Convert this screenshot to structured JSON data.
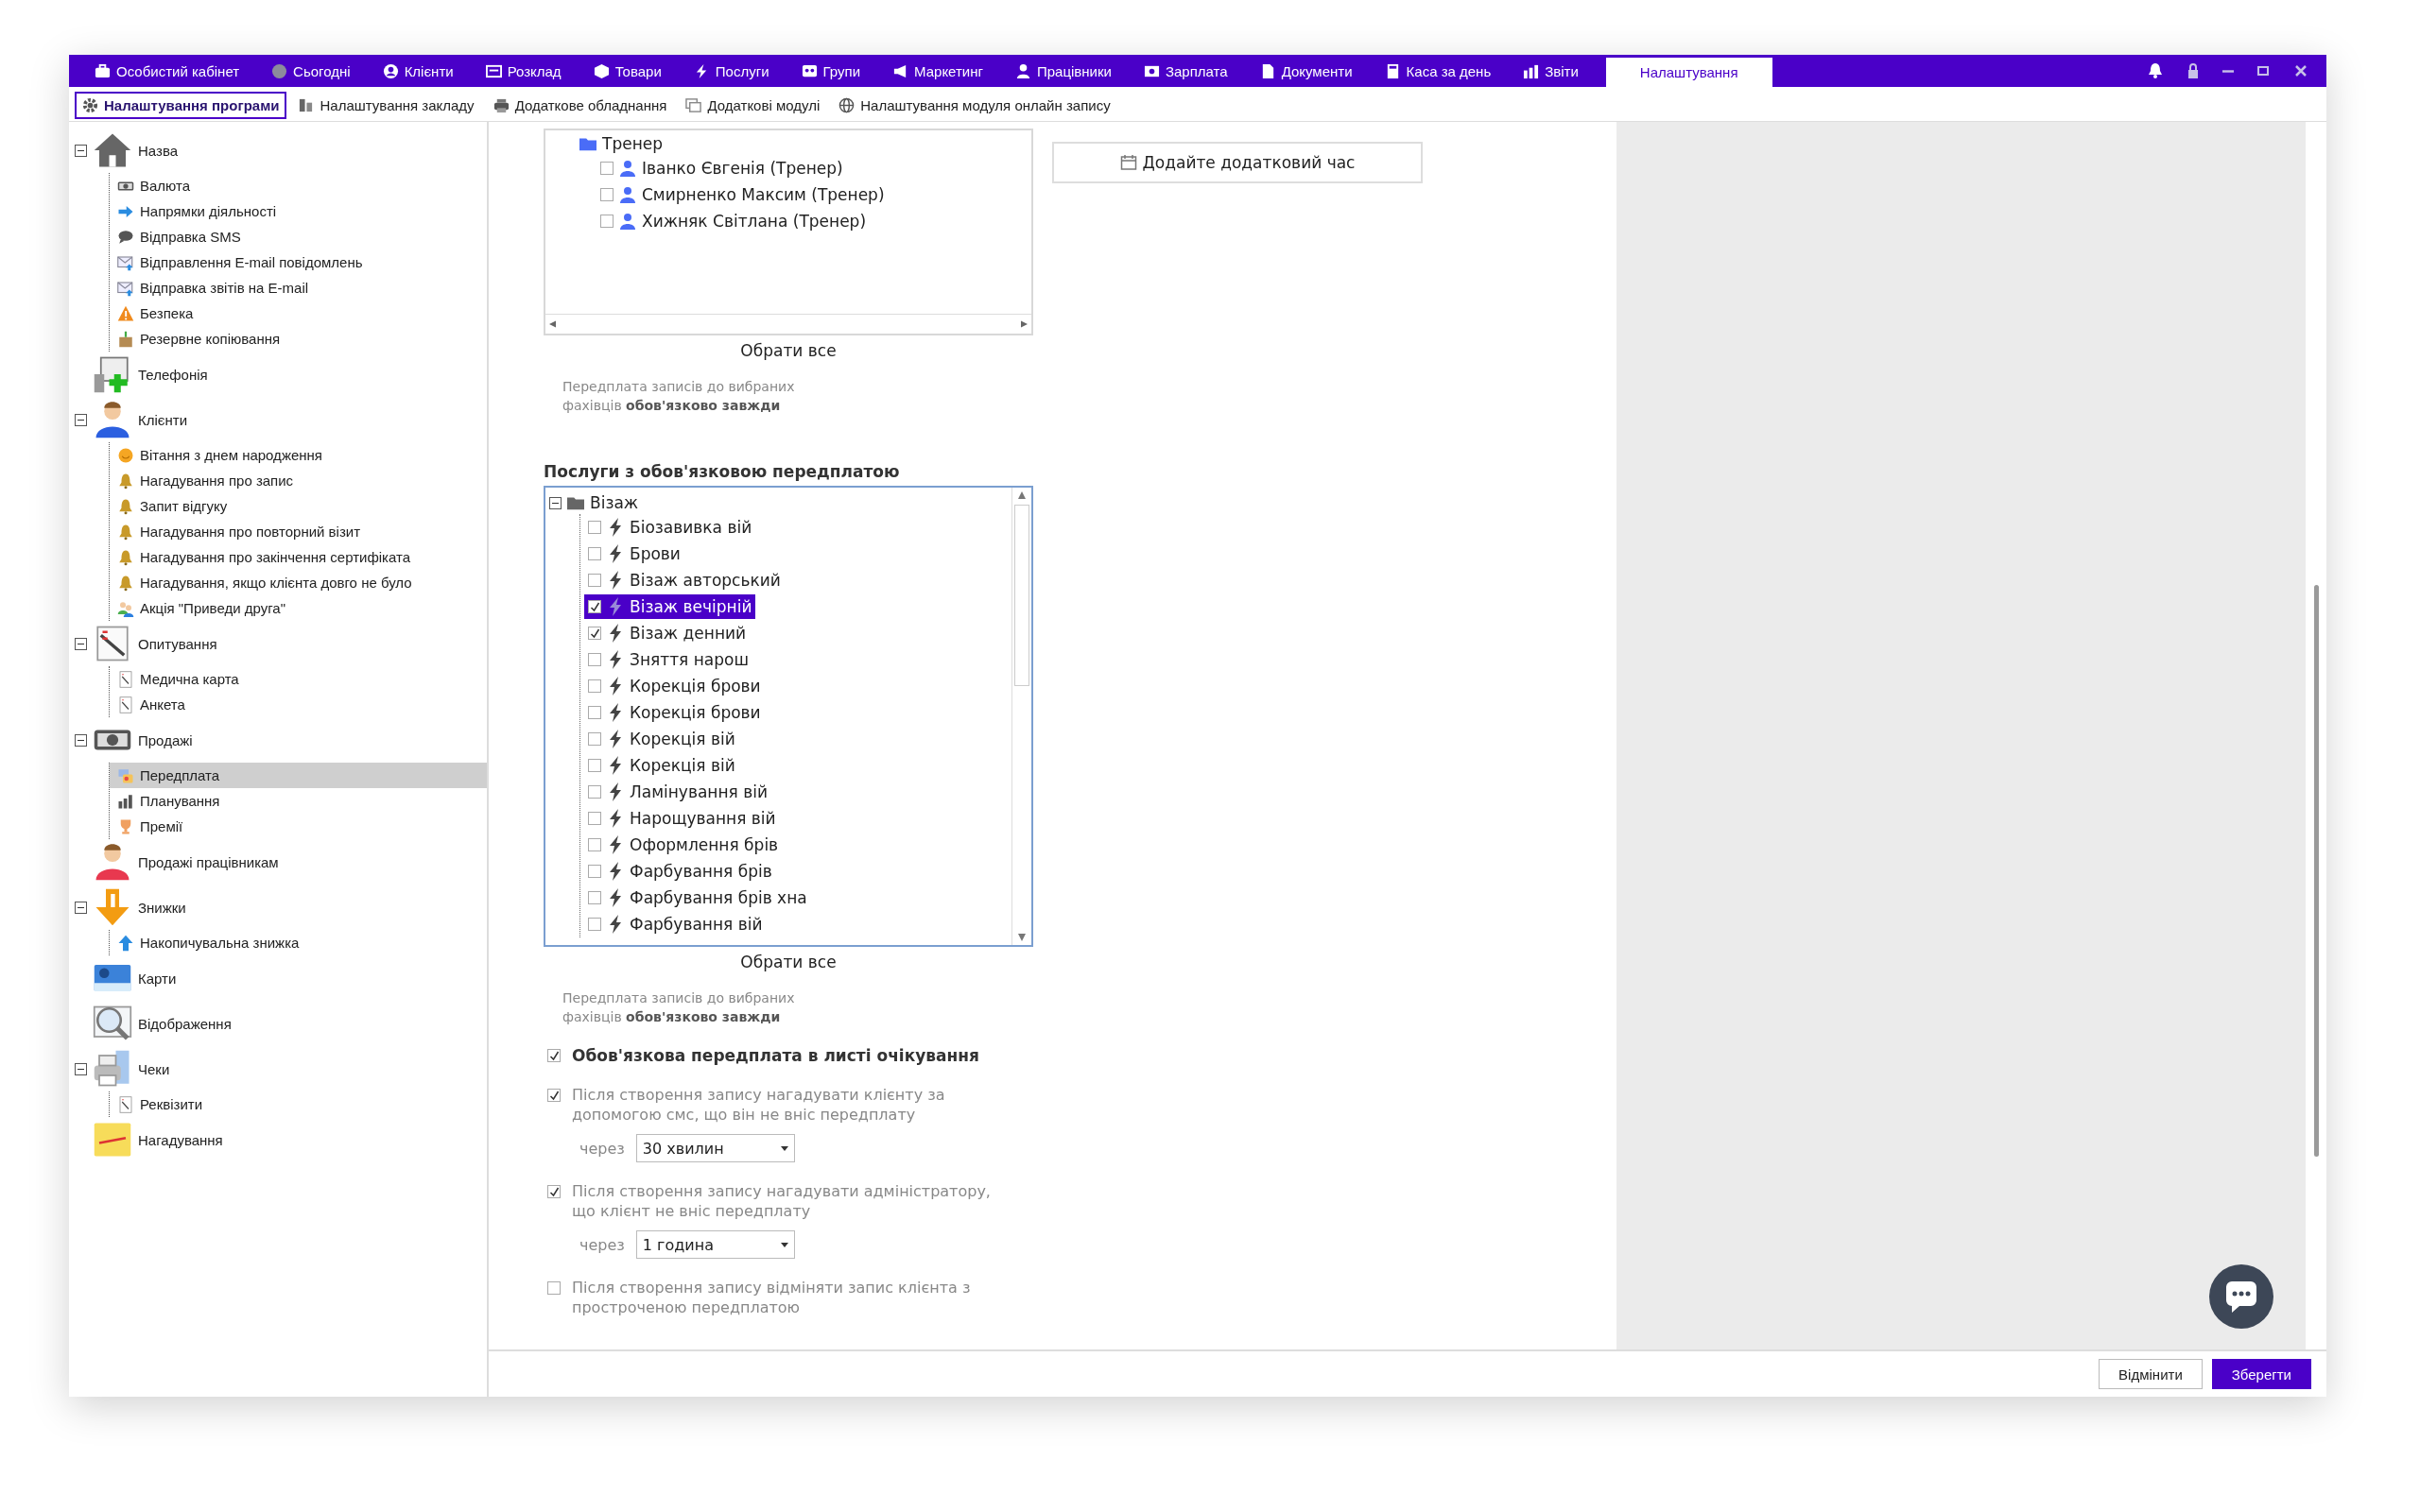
{
  "top_nav": {
    "items": [
      {
        "label": "Особистий кабінет",
        "selected": false
      },
      {
        "label": "Сьогодні",
        "selected": false
      },
      {
        "label": "Клієнти",
        "selected": false
      },
      {
        "label": "Розклад",
        "selected": false
      },
      {
        "label": "Товари",
        "selected": false
      },
      {
        "label": "Послуги",
        "selected": false
      },
      {
        "label": "Групи",
        "selected": false
      },
      {
        "label": "Маркетинг",
        "selected": false
      },
      {
        "label": "Працівники",
        "selected": false
      },
      {
        "label": "Зарплата",
        "selected": false
      },
      {
        "label": "Документи",
        "selected": false
      },
      {
        "label": "Каса за день",
        "selected": false
      },
      {
        "label": "Звіти",
        "selected": false
      },
      {
        "label": "Налаштування",
        "selected": true
      }
    ]
  },
  "sub_tabs": [
    {
      "label": "Налаштування програми",
      "selected": true
    },
    {
      "label": "Налаштування закладу",
      "selected": false
    },
    {
      "label": "Додаткове обладнання",
      "selected": false
    },
    {
      "label": "Додаткові модулі",
      "selected": false
    },
    {
      "label": "Налаштування модуля онлайн запису",
      "selected": false
    }
  ],
  "sidebar": {
    "items": [
      {
        "label": "Назва",
        "expanded": true,
        "selected": false,
        "children": [
          {
            "label": "Валюта",
            "selected": false
          },
          {
            "label": "Напрямки діяльності",
            "selected": false
          },
          {
            "label": "Відправка SMS",
            "selected": false
          },
          {
            "label": "Відправлення E-mail повідомлень",
            "selected": false
          },
          {
            "label": "Відправка звітів на E-mail",
            "selected": false
          },
          {
            "label": "Безпека",
            "selected": false
          },
          {
            "label": "Резервне копіювання",
            "selected": false
          }
        ]
      },
      {
        "label": "Телефонія",
        "selected": false
      },
      {
        "label": "Клієнти",
        "expanded": true,
        "selected": false,
        "children": [
          {
            "label": "Вітання з днем народження",
            "selected": false
          },
          {
            "label": "Нагадування про запис",
            "selected": false
          },
          {
            "label": "Запит відгуку",
            "selected": false
          },
          {
            "label": "Нагадування про повторний візит",
            "selected": false
          },
          {
            "label": "Нагадування про закінчення сертифіката",
            "selected": false
          },
          {
            "label": "Нагадування, якщо клієнта довго не було",
            "selected": false
          },
          {
            "label": "Акція \"Приведи друга\"",
            "selected": false
          }
        ]
      },
      {
        "label": "Опитування",
        "expanded": true,
        "selected": false,
        "children": [
          {
            "label": "Медична карта",
            "selected": false
          },
          {
            "label": "Анкета",
            "selected": false
          }
        ]
      },
      {
        "label": "Продажі",
        "expanded": true,
        "selected": false,
        "children": [
          {
            "label": "Передплата",
            "selected": true
          },
          {
            "label": "Планування",
            "selected": false
          },
          {
            "label": "Премії",
            "selected": false
          }
        ]
      },
      {
        "label": "Продажі працівникам",
        "selected": false
      },
      {
        "label": "Знижки",
        "expanded": true,
        "selected": false,
        "children": [
          {
            "label": "Накопичувальна знижка",
            "selected": false
          }
        ]
      },
      {
        "label": "Карти",
        "selected": false
      },
      {
        "label": "Відображення",
        "selected": false
      },
      {
        "label": "Чеки",
        "expanded": true,
        "selected": false,
        "children": [
          {
            "label": "Реквізити",
            "selected": false
          }
        ]
      },
      {
        "label": "Нагадування",
        "selected": false
      }
    ]
  },
  "specialists": {
    "group": "Тренер",
    "items": [
      {
        "label": "Іванко Євгенія (Тренер)",
        "checked": false
      },
      {
        "label": "Смирненко Максим (Тренер)",
        "checked": false
      },
      {
        "label": "Хижняк Світлана (Тренер)",
        "checked": false
      }
    ],
    "select_all": "Обрати все",
    "note": "Передплата записів до вибраних фахівців **обов'язково завжди**"
  },
  "add_time_button": "Додайте додатковий час",
  "services": {
    "title": "Послуги з обов'язковою передплатою",
    "group": {
      "label": "Візаж",
      "expanded": true,
      "items": [
        {
          "label": "Біозавивка вій",
          "checked": false,
          "selected": false
        },
        {
          "label": "Брови",
          "checked": false,
          "selected": false
        },
        {
          "label": "Візаж авторський",
          "checked": false,
          "selected": false
        },
        {
          "label": "Візаж вечірній",
          "checked": true,
          "selected": true
        },
        {
          "label": "Візаж денний",
          "checked": true,
          "selected": false
        },
        {
          "label": "Зняття нарош",
          "checked": false,
          "selected": false
        },
        {
          "label": "Корекція брови",
          "checked": false,
          "selected": false
        },
        {
          "label": "Корекція брови",
          "checked": false,
          "selected": false
        },
        {
          "label": "Корекція вій",
          "checked": false,
          "selected": false
        },
        {
          "label": "Корекція вій",
          "checked": false,
          "selected": false
        },
        {
          "label": "Ламінування вій",
          "checked": false,
          "selected": false
        },
        {
          "label": "Нарощування вій",
          "checked": false,
          "selected": false
        },
        {
          "label": "Оформлення брів",
          "checked": false,
          "selected": false
        },
        {
          "label": "Фарбування брів",
          "checked": false,
          "selected": false
        },
        {
          "label": "Фарбування брів хна",
          "checked": false,
          "selected": false
        },
        {
          "label": "Фарбування вій",
          "checked": false,
          "selected": false
        }
      ]
    },
    "select_all": "Обрати все",
    "note": "Передплата записів до вибраних фахівців **обов'язково завжди**"
  },
  "options": [
    {
      "kind": "heading",
      "label": "Обов'язкова передплата в листі очікування",
      "checked": true
    },
    {
      "kind": "reminder",
      "label": "Після створення запису нагадувати клієнту за допомогою смс, що він не вніс передплату",
      "checked": true,
      "delay": {
        "label": "через",
        "value": "30 хвилин"
      }
    },
    {
      "kind": "reminder",
      "label": "Після створення запису нагадувати адміністратору, що клієнт не вніс передплату",
      "checked": true,
      "delay": {
        "label": "через",
        "value": "1 година"
      }
    },
    {
      "kind": "reminder",
      "label": "Після створення запису відміняти запис клієнта з простроченою передплатою",
      "checked": false
    }
  ],
  "footer": {
    "buttons": [
      {
        "label": "Відмінити",
        "kind": "secondary"
      },
      {
        "label": "Зберегти",
        "kind": "primary"
      }
    ]
  }
}
